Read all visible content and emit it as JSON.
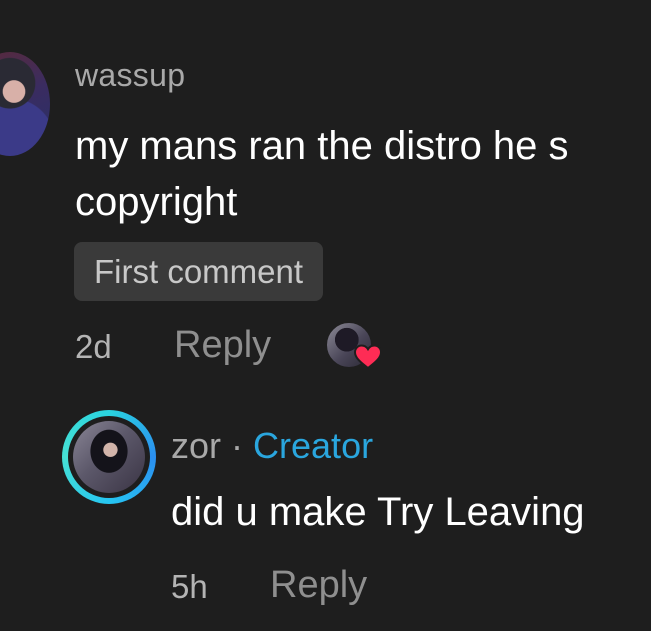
{
  "comment": {
    "username": "wassup",
    "text_lines": [
      "my mans ran the distro he s",
      "copyright"
    ],
    "badge": "First comment",
    "time": "2d",
    "reply_label": "Reply",
    "liked_by_creator": true
  },
  "reply": {
    "username": "zor",
    "separator": "·",
    "creator_label": "Creator",
    "text": "did u make Try Leaving",
    "time": "5h",
    "reply_label": "Reply"
  },
  "colors": {
    "background": "#1e1e1e",
    "creator_accent": "#2aa6de",
    "heart": "#fe2c55",
    "badge_bg": "#3a3a3a"
  },
  "icons": {
    "heart": "heart-icon"
  }
}
